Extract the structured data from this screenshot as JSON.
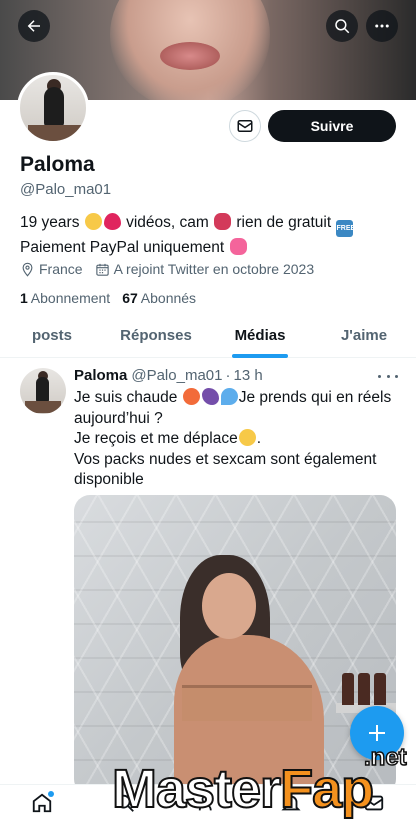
{
  "profile": {
    "name": "Paloma",
    "handle": "@Palo_ma01",
    "follow_label": "Suivre",
    "bio": {
      "line1_a": "19 years ",
      "line1_b": " vidéos, cam ",
      "line1_c": " rien de gratuit ",
      "line2": "Paiement PayPal uniquement "
    },
    "location": "France",
    "joined": "A rejoint Twitter en octobre 2023",
    "following_count": "1",
    "following_label": "Abonnement",
    "followers_count": "67",
    "followers_label": "Abonnés"
  },
  "tabs": [
    {
      "label": "posts",
      "active": false
    },
    {
      "label": "Réponses",
      "active": false
    },
    {
      "label": "Médias",
      "active": true
    },
    {
      "label": "J'aime",
      "active": false
    }
  ],
  "tweet": {
    "name": "Paloma",
    "handle": "@Palo_ma01",
    "dot": "·",
    "time": "13 h",
    "line1_a": "Je suis chaude ",
    "line1_b": "Je prends qui en réels",
    "line2": "aujourd’hui ?",
    "line3": "Je reçois et me déplace",
    "line3_end": ".",
    "line4": "Vos packs nudes et sexcam sont également",
    "line5": "disponible"
  },
  "emoji_free": "FREE",
  "watermark": {
    "master": "Master",
    "fap": "Fap",
    "net": ".net"
  },
  "colors": {
    "accent": "#1d9bf0",
    "text": "#0f1419",
    "secondary": "#536471"
  }
}
